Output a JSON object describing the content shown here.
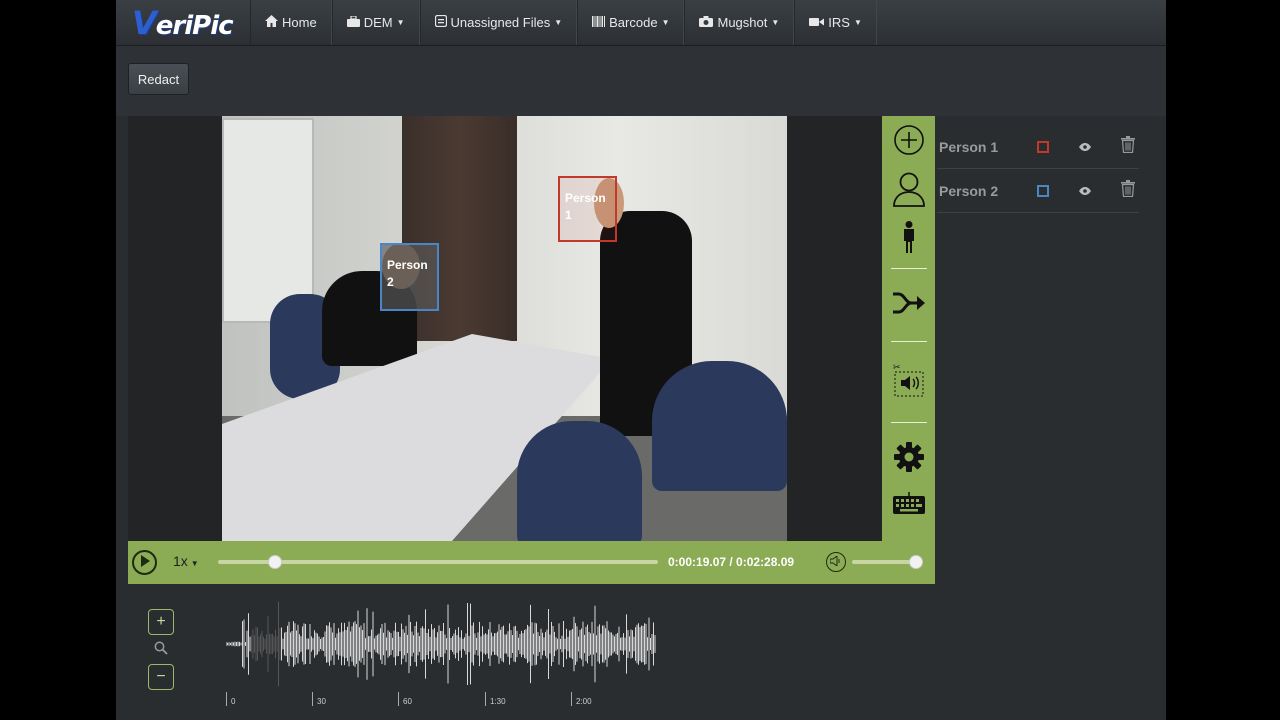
{
  "brand": {
    "logo_text": "VeriPic"
  },
  "nav": {
    "items": [
      {
        "label": "Home",
        "icon": "home-icon",
        "has_caret": false
      },
      {
        "label": "DEM",
        "icon": "briefcase-icon",
        "has_caret": true
      },
      {
        "label": "Unassigned Files",
        "icon": "files-icon",
        "has_caret": true
      },
      {
        "label": "Barcode",
        "icon": "barcode-icon",
        "has_caret": true
      },
      {
        "label": "Mugshot",
        "icon": "camera-icon",
        "has_caret": true
      },
      {
        "label": "IRS",
        "icon": "video-camera-icon",
        "has_caret": true
      }
    ]
  },
  "toolbar": {
    "redact_label": "Redact"
  },
  "video": {
    "boxes": [
      {
        "label": "Person 1",
        "color": "#c0392b"
      },
      {
        "label": "Person 2",
        "color": "#4a86c5"
      }
    ]
  },
  "player": {
    "speed": "1x",
    "time": "0:00:19.07 / 0:02:28.09",
    "progress_fraction": 0.13,
    "volume_fraction": 0.97
  },
  "sidebar_tools": [
    "add-icon",
    "face-icon",
    "person-icon",
    "merge-icon",
    "audio-redact-icon",
    "settings-icon",
    "keyboard-icon"
  ],
  "people": [
    {
      "name": "Person 1",
      "color": "#c0392b"
    },
    {
      "name": "Person 2",
      "color": "#4a86c5"
    }
  ],
  "waveform": {
    "zoom_in": "+",
    "zoom_out": "−",
    "ticks": [
      "0",
      "30",
      "60",
      "1:30",
      "2:00"
    ]
  },
  "colors": {
    "accent": "#8bab55",
    "background": "#2a2d30",
    "navbar": "#353a3f"
  }
}
